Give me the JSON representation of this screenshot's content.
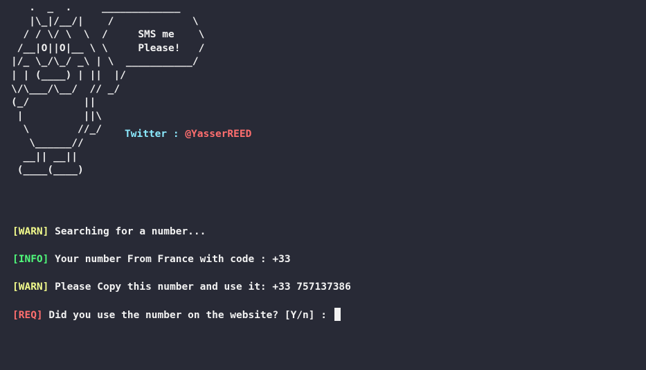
{
  "terminal": {
    "ascii_art": "   .  _  .     _____________\n   |\\_|/__/|    /             \\\n  / / \\/ \\  \\  /     SMS me    \\\n /__|O||O|__ \\ \\     Please!   /\n|/_ \\_/\\_/ _\\ | \\  ___________/\n| | (____) | ||  |/\n\\/\\___/\\__/  // _/\n(_/         ||\n |          ||\\\n  \\        //_/\n   \\______//\n  __|| __||\n (____(____)",
    "twitter_label": "Twitter : ",
    "twitter_handle": "@YasserREED",
    "lines": [
      {
        "tag": "[WARN]",
        "text": " Searching for a number..."
      },
      {
        "tag": "[INFO]",
        "text": " Your number From France with code : +33"
      },
      {
        "tag": "[WARN]",
        "text": " Please Copy this number and use it: +33 757137386"
      },
      {
        "tag": "[REQ]",
        "text": " Did you use the number on the website? [Y/n] : "
      }
    ]
  },
  "colors": {
    "background": "#282a36",
    "foreground": "#f2f2f2",
    "warn": "#f1fa8c",
    "info": "#50fa7b",
    "req": "#ff6e6e",
    "twitter_label": "#8be9fd",
    "twitter_handle": "#ff6e6e"
  }
}
